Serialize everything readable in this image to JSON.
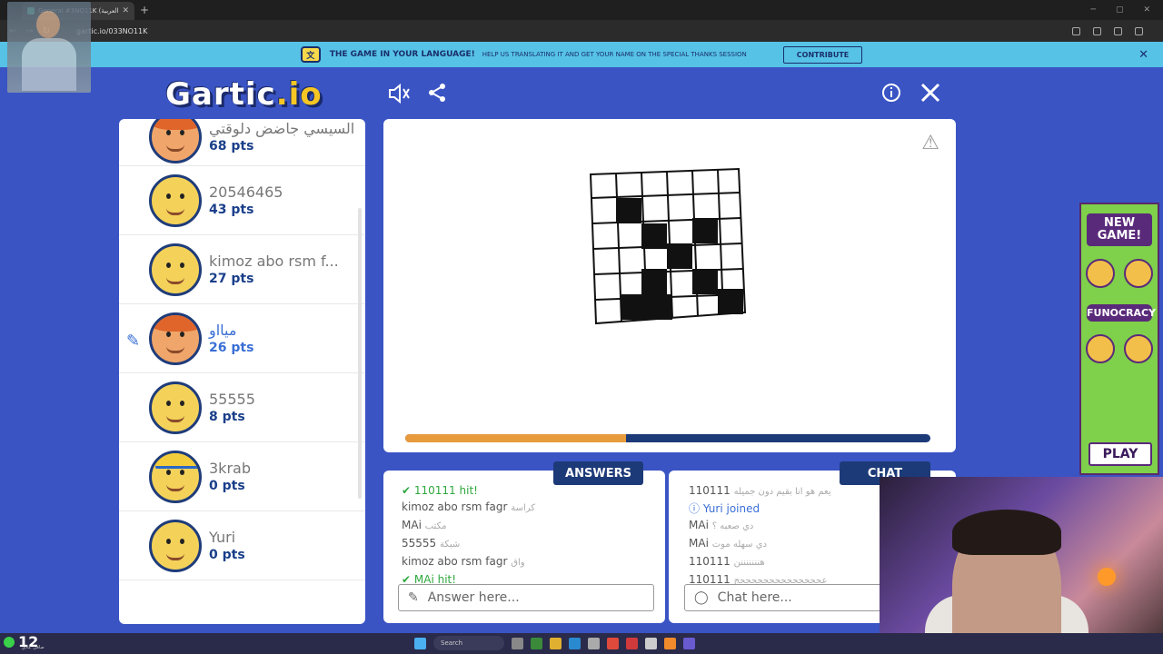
{
  "browser": {
    "tab_title": "General #3NO11K (العربية) - Gartic",
    "url": "gartic.io/033NO11K"
  },
  "banner": {
    "main_text": "THE GAME IN YOUR LANGUAGE!",
    "sub_text": "HELP US TRANSLATING IT AND GET YOUR NAME ON THE SPECIAL THANKS SESSION",
    "contribute_label": "CONTRIBUTE"
  },
  "header": {
    "logo_main": "Gartic",
    "logo_io": ".io"
  },
  "players": [
    {
      "name": "السيسي جاضض دلوقتي",
      "points": "68 pts",
      "avatar": "red"
    },
    {
      "name": "20546465",
      "points": "43 pts",
      "avatar": "yellow"
    },
    {
      "name": "kimoz abo rsm f...",
      "points": "27 pts",
      "avatar": "yellow"
    },
    {
      "name": "ميااو",
      "points": "26 pts",
      "avatar": "red",
      "drawing": true
    },
    {
      "name": "55555",
      "points": "8 pts",
      "avatar": "yellow"
    },
    {
      "name": "3krab",
      "points": "0 pts",
      "avatar": "cap"
    },
    {
      "name": "Yuri",
      "points": "0 pts",
      "avatar": "yellow"
    }
  ],
  "round_progress": 0.42,
  "answers": {
    "tab_label": "ANSWERS",
    "messages": [
      {
        "user": "110111",
        "text": "hit!",
        "type": "hit"
      },
      {
        "user": "kimoz abo rsm fagr",
        "text": "كراسة",
        "type": "guess"
      },
      {
        "user": "MAi",
        "text": "مكتب",
        "type": "guess"
      },
      {
        "user": "55555",
        "text": "شبكة",
        "type": "guess"
      },
      {
        "user": "kimoz abo rsm fagr",
        "text": "واق",
        "type": "guess"
      },
      {
        "user": "MAi",
        "text": "hit!",
        "type": "hit"
      }
    ],
    "placeholder": "Answer here..."
  },
  "chat": {
    "tab_label": "CHAT",
    "messages": [
      {
        "user": "110111",
        "text": "يعم هو انا بقيم دون جميله",
        "type": "msg"
      },
      {
        "user": "Yuri",
        "text": "joined",
        "type": "info"
      },
      {
        "user": "MAi",
        "text": "دي صعبه ؟",
        "type": "msg"
      },
      {
        "user": "MAi",
        "text": "دي سهله موت",
        "type": "msg"
      },
      {
        "user": "110111",
        "text": "هنننننننن",
        "type": "msg"
      },
      {
        "user": "110111",
        "text": "عججججججججججججججج",
        "type": "msg"
      }
    ],
    "placeholder": "Chat here..."
  },
  "ad": {
    "headline": "NEW GAME!",
    "brand": "FUNOCRACY",
    "play_label": "PLAY"
  },
  "taskbar": {
    "badge_number": "12",
    "badge_sub": "صافي عادي",
    "search_label": "Search"
  }
}
